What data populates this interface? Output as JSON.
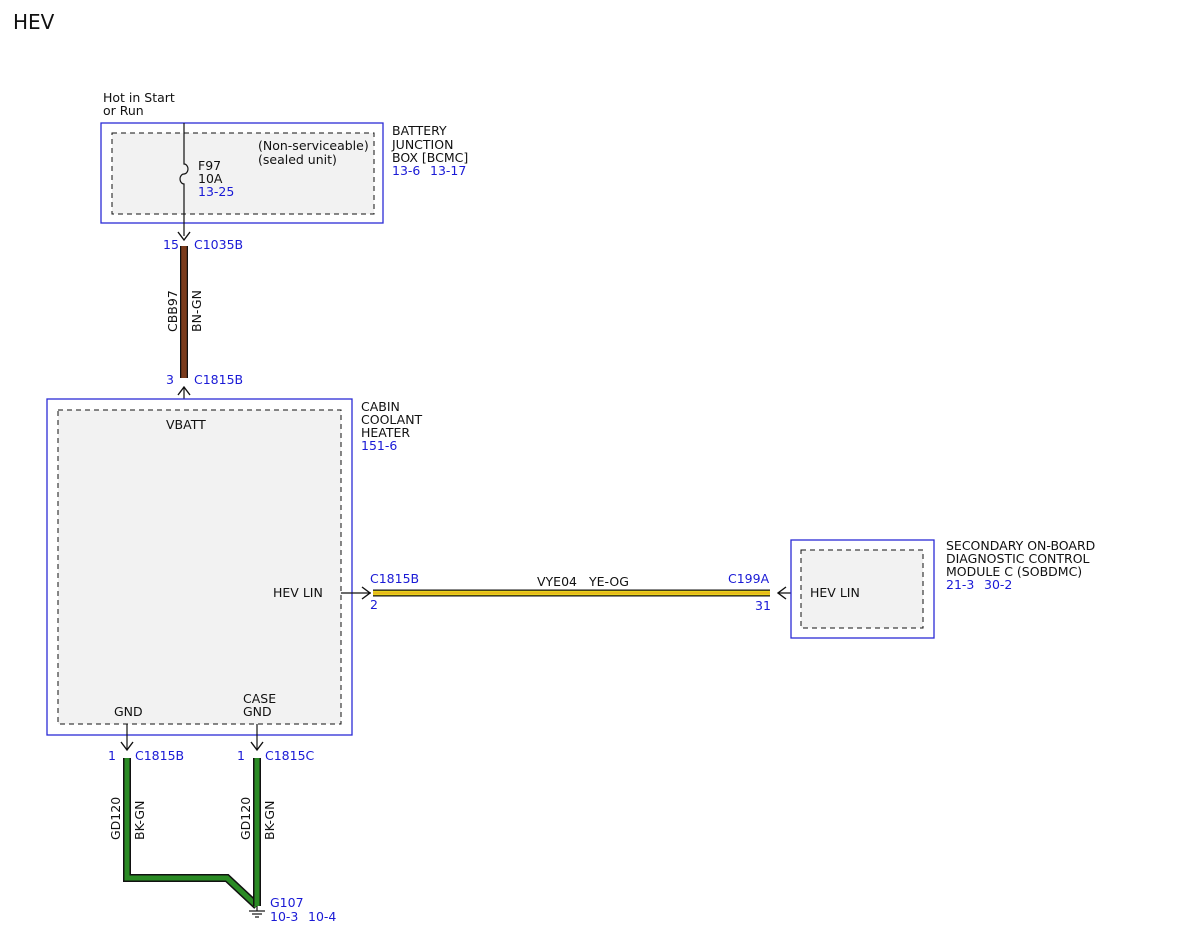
{
  "title": "HEV",
  "colors": {
    "module_border": "#2b2bd6",
    "module_fill": "#f2f2f2",
    "wire_brown": "#7a3b1c",
    "wire_green": "#2a8a24",
    "wire_yellow": "#e7d21a",
    "ref_text": "#1a1ad6"
  },
  "power_source": {
    "line1": "Hot in Start",
    "line2": "or Run"
  },
  "bjb": {
    "name1": "BATTERY",
    "name2": "JUNCTION",
    "name3": "BOX [BCMC]",
    "ref1": "13-6",
    "ref2": "13-17",
    "note1": "(Non-serviceable)",
    "note2": "(sealed unit)",
    "fuse_name": "F97",
    "fuse_rating": "10A",
    "fuse_ref": "13-25"
  },
  "wire_cbb97": {
    "circuit": "CBB97",
    "color": "BN-GN",
    "top_pin": "15",
    "top_connector": "C1035B",
    "bottom_pin": "3",
    "bottom_connector": "C1815B"
  },
  "heater": {
    "name1": "CABIN",
    "name2": "COOLANT",
    "name3": "HEATER",
    "ref": "151-6",
    "vbatt": "VBATT",
    "hev_lin": "HEV LIN",
    "gnd": "GND",
    "case_gnd1": "CASE",
    "case_gnd2": "GND"
  },
  "lin_wire": {
    "left_connector": "C1815B",
    "left_pin": "2",
    "circuit": "VYE04",
    "color": "YE-OG",
    "right_connector": "C199A",
    "right_pin": "31"
  },
  "sobdmc": {
    "name1": "SECONDARY ON-BOARD",
    "name2": "DIAGNOSTIC CONTROL",
    "name3": "MODULE C (SOBDMC)",
    "ref1": "21-3",
    "ref2": "30-2",
    "hev_lin": "HEV LIN"
  },
  "gnd_wire_1": {
    "pin": "1",
    "connector": "C1815B",
    "circuit": "GD120",
    "color": "BK-GN"
  },
  "gnd_wire_2": {
    "pin": "1",
    "connector": "C1815C",
    "circuit": "GD120",
    "color": "BK-GN"
  },
  "ground": {
    "name": "G107",
    "ref1": "10-3",
    "ref2": "10-4"
  }
}
